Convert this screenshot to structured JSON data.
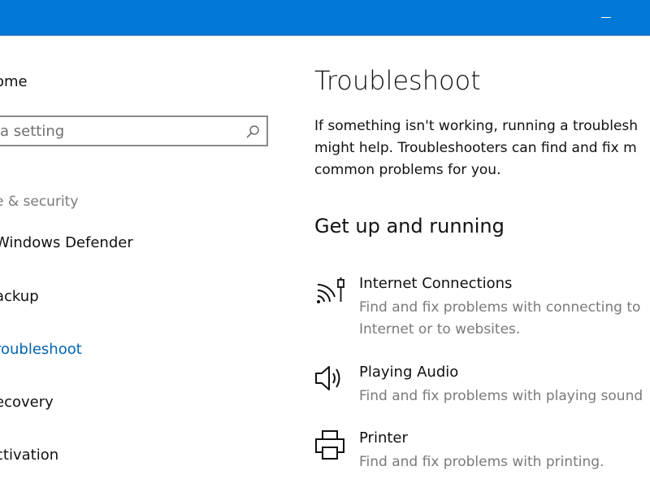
{
  "sidebar": {
    "home_label": "ome",
    "search_placeholder": "a setting",
    "section_label": "e & security",
    "items": [
      {
        "label": "Windows Defender",
        "active": false
      },
      {
        "label": "ackup",
        "active": false
      },
      {
        "label": "roubleshoot",
        "active": true
      },
      {
        "label": "ecovery",
        "active": false
      },
      {
        "label": "ctivation",
        "active": false
      }
    ]
  },
  "main": {
    "title": "Troubleshoot",
    "description_lines": [
      "If something isn't working, running a troublesh",
      "might help. Troubleshooters can find and fix m",
      "common problems for you."
    ],
    "section_heading": "Get up and running",
    "troubleshooters": [
      {
        "title": "Internet Connections",
        "description_lines": [
          "Find and fix problems with connecting to",
          "Internet or to websites."
        ],
        "icon": "wifi-icon"
      },
      {
        "title": "Playing Audio",
        "description_lines": [
          "Find and fix problems with playing sound"
        ],
        "icon": "speaker-icon"
      },
      {
        "title": "Printer",
        "description_lines": [
          "Find and fix problems with printing."
        ],
        "icon": "printer-icon"
      }
    ]
  },
  "colors": {
    "titlebar": "#0078d7",
    "accent_text": "#0063b1",
    "secondary_text": "#7a7a7a"
  }
}
